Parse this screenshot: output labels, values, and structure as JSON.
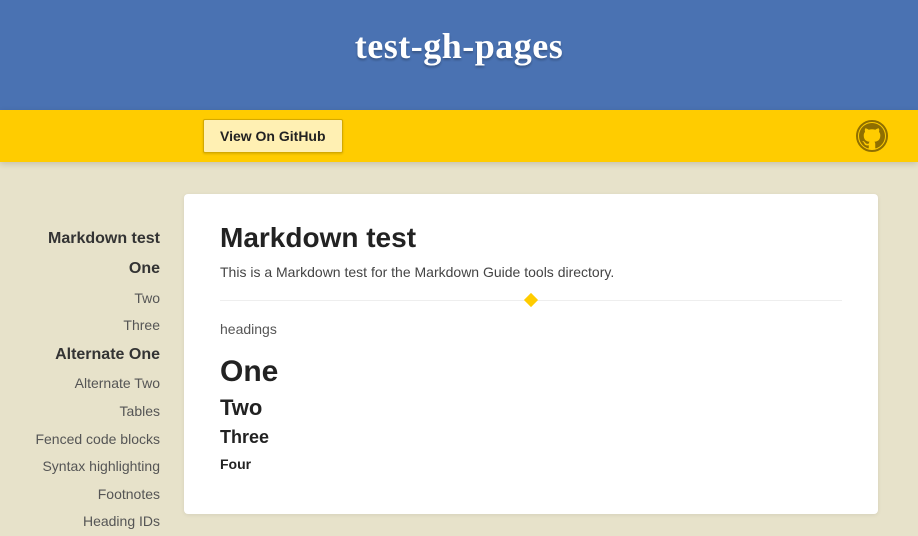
{
  "hero": {
    "title": "test-gh-pages"
  },
  "banner": {
    "button_label": "View On GitHub"
  },
  "sidebar": {
    "items": [
      {
        "label": "Markdown test",
        "level": 1
      },
      {
        "label": "One",
        "level": 2
      },
      {
        "label": "Two",
        "level": 3
      },
      {
        "label": "Three",
        "level": 3
      },
      {
        "label": "Alternate One",
        "level": 2
      },
      {
        "label": "Alternate Two",
        "level": 3
      },
      {
        "label": "Tables",
        "level": 3
      },
      {
        "label": "Fenced code blocks",
        "level": 3
      },
      {
        "label": "Syntax highlighting",
        "level": 3
      },
      {
        "label": "Footnotes",
        "level": 3
      },
      {
        "label": "Heading IDs",
        "level": 3
      }
    ]
  },
  "article": {
    "title": "Markdown test",
    "description": "This is a Markdown test for the Markdown Guide tools directory.",
    "section_label": "headings",
    "h1": "One",
    "h2": "Two",
    "h3": "Three",
    "h4": "Four"
  }
}
